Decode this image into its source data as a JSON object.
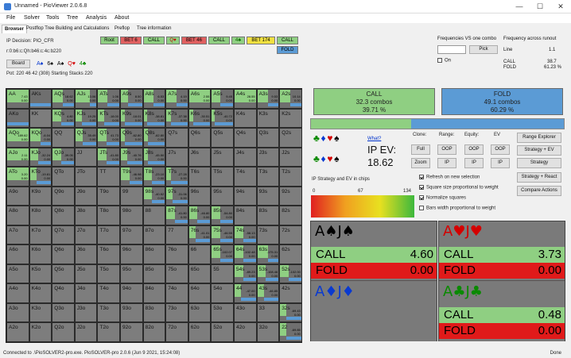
{
  "window": {
    "title": "Unnamed - PioViewer 2.0.6.8",
    "minimize": "—",
    "maximize": "☐",
    "close": "✕"
  },
  "menu": [
    "File",
    "Solver",
    "Tools",
    "Tree",
    "Analysis",
    "About"
  ],
  "tabs": [
    "Browser",
    "Postflop Tree Building and Calculations",
    "Preflop",
    "Tree information"
  ],
  "info": {
    "ip_decision": "IP Decision:  PIO_CFR",
    "board_cards": "r:0:b6:c:Qh:b46:c:4c:b220",
    "board_button": "Board",
    "board_suits": [
      "A♠",
      "6♠",
      "A♠",
      "Q♥",
      "4♣"
    ],
    "pot": "Pot: 220 46 42 (308) Starting Stacks 220"
  },
  "tree_nodes": [
    {
      "label": "Root",
      "color": "#8fcf82"
    },
    {
      "label": "BET 6",
      "color": "#e06060"
    },
    {
      "label": "CALL",
      "color": "#8fcf82"
    },
    {
      "label": "Q♥",
      "color": "#8fcf82"
    },
    {
      "label": "BET 46",
      "color": "#e06060"
    },
    {
      "label": "CALL",
      "color": "#8fcf82"
    },
    {
      "label": "4♣",
      "color": "#8fcf82"
    },
    {
      "label": "BET 174",
      "color": "#f0e040"
    },
    {
      "label": "CALL",
      "color": "#8fcf82"
    },
    {
      "label": "FOLD",
      "color": "#5b9bd5"
    }
  ],
  "freq_panel": {
    "title": "Frequencies VS one combo",
    "pick": "Pick",
    "on": "On",
    "across_title": "Frequency across runout",
    "line": "Line",
    "line_val": "1.1",
    "call": "CALL",
    "call_val": "38.7",
    "fold": "FOLD",
    "fold_val": "61.23 %"
  },
  "grid": [
    [
      "AA",
      "AKs",
      "AQs",
      "AJs",
      "ATs",
      "A9s",
      "A8s",
      "A7s",
      "A6s",
      "A5s",
      "A4s",
      "A3s",
      "A2s"
    ],
    [
      "AKo",
      "KK",
      "KQs",
      "KJs",
      "KTs",
      "K9s",
      "K8s",
      "K7s",
      "K6s",
      "K5s",
      "K4s",
      "K3s",
      "K2s"
    ],
    [
      "AQo",
      "KQo",
      "QQ",
      "QJs",
      "QTs",
      "Q9s",
      "Q8s",
      "Q7s",
      "Q6s",
      "Q5s",
      "Q4s",
      "Q3s",
      "Q2s"
    ],
    [
      "AJo",
      "KJo",
      "QJo",
      "JJ",
      "JTs",
      "J9s",
      "J8s",
      "J7s",
      "J6s",
      "J5s",
      "J4s",
      "J3s",
      "J2s"
    ],
    [
      "ATo",
      "KTo",
      "QTo",
      "JTo",
      "TT",
      "T9s",
      "T8s",
      "T7s",
      "T6s",
      "T5s",
      "T4s",
      "T3s",
      "T2s"
    ],
    [
      "A9o",
      "K9o",
      "Q9o",
      "J9o",
      "T9o",
      "99",
      "98s",
      "97s",
      "96s",
      "95s",
      "94s",
      "93s",
      "92s"
    ],
    [
      "A8o",
      "K8o",
      "Q8o",
      "J8o",
      "T8o",
      "98o",
      "88",
      "87s",
      "86s",
      "85s",
      "84s",
      "83s",
      "82s"
    ],
    [
      "A7o",
      "K7o",
      "Q7o",
      "J7o",
      "T7o",
      "97o",
      "87o",
      "77",
      "76s",
      "75s",
      "74s",
      "73s",
      "72s"
    ],
    [
      "A6o",
      "K6o",
      "Q6o",
      "J6o",
      "T6o",
      "96o",
      "86o",
      "76o",
      "66",
      "65s",
      "64s",
      "63s",
      "62s"
    ],
    [
      "A5o",
      "K5o",
      "Q5o",
      "J5o",
      "T5o",
      "95o",
      "85o",
      "75o",
      "65o",
      "55",
      "54s",
      "53s",
      "52s"
    ],
    [
      "A4o",
      "K4o",
      "Q4o",
      "J4o",
      "T4o",
      "94o",
      "84o",
      "74o",
      "64o",
      "54o",
      "44",
      "43s",
      "42s"
    ],
    [
      "A3o",
      "K3o",
      "Q3o",
      "J3o",
      "T3o",
      "93o",
      "83o",
      "73o",
      "63o",
      "53o",
      "43o",
      "33",
      "32s"
    ],
    [
      "A2o",
      "K2o",
      "Q2o",
      "J2o",
      "T2o",
      "92o",
      "82o",
      "72o",
      "62o",
      "52o",
      "42o",
      "32o",
      "22"
    ]
  ],
  "cell_values": {
    "AA": {
      "call": 1,
      "nums": "7.43\n0.00"
    },
    "AKs": {
      "call": 0,
      "nums": ""
    },
    "AQs": {
      "call": 0.5,
      "nums": "18.62\n0.00"
    },
    "AJs": {
      "call": 0.7,
      "nums": "13.06\n0.00"
    },
    "ATs": {
      "call": 0.45,
      "nums": "1.06\n0.00"
    },
    "A9s": {
      "call": 0.35,
      "nums": "8.50\n0.00"
    },
    "A8s": {
      "call": 0.45,
      "nums": "6.53\n0.00"
    },
    "A7s": {
      "call": 0.5,
      "nums": "4.19\n0.00"
    },
    "A6s": {
      "call": 1,
      "nums": "2.55\n0.00"
    },
    "A5s": {
      "call": 0.4,
      "nums": "9.45\n0.00"
    },
    "A4s": {
      "call": 1,
      "nums": "28.55\n0.00"
    },
    "A3s": {
      "call": 0.5,
      "nums": "9.53\n0.00"
    },
    "A2s": {
      "call": 0.5,
      "nums": "10.14\n0.00"
    },
    "AKo": {
      "call": 0,
      "nums": ""
    },
    "KQs": {
      "call": 0.4,
      "nums": "4.80\n0.00"
    },
    "KJs": {
      "call": 0.3,
      "nums": "19.25\n0.00"
    },
    "KTs": {
      "call": 0.3,
      "nums": "-18.00\n0.00"
    },
    "K9s": {
      "call": 0.2,
      "nums": "-18.01\n0.00"
    },
    "K8s": {
      "call": 0.15,
      "nums": "-38.81\n0.00"
    },
    "K7s": {
      "call": 0.2,
      "nums": "-37.38\n0.00"
    },
    "K6s": {
      "call": 0.2,
      "nums": "-30.51\n0.00"
    },
    "K5s": {
      "call": 0.15,
      "nums": "-40.72\n0.00"
    },
    "AQo": {
      "call": 1,
      "nums": "189.62\n0.00"
    },
    "KQo": {
      "call": 0.5,
      "nums": "-6.04\n0.00"
    },
    "QJs": {
      "call": 0.35,
      "nums": "35.49\n0.00"
    },
    "QTs": {
      "call": 0.4,
      "nums": "41.73\n0.00"
    },
    "Q9s": {
      "call": 0.2,
      "nums": "-62.80\n0.00"
    },
    "Q8s": {
      "call": 0.2,
      "nums": "-62.80\n0.00"
    },
    "AJo": {
      "call": 1,
      "nums": "2.11\n0.00"
    },
    "KJo": {
      "call": 0.4,
      "nums": "-32.24\n0.00"
    },
    "QJo": {
      "call": 0.4,
      "nums": "-39.05\n0.00"
    },
    "JTs": {
      "call": 0.4,
      "nums": "-41.80\n0.00"
    },
    "J9s": {
      "call": 0.3,
      "nums": "-40.76\n0.00"
    },
    "J8s": {
      "call": 0.2,
      "nums": "-45.50\n0.00"
    },
    "ATo": {
      "call": 1,
      "nums": "3.20\n0.00"
    },
    "KTo": {
      "call": 0.3,
      "nums": "-19.81\n0.00"
    },
    "T9s": {
      "call": 0.4,
      "nums": "-46.98\n0.00"
    },
    "T8s": {
      "call": 0.4,
      "nums": "-23.10\n0.00"
    },
    "T7s": {
      "call": 0.2,
      "nums": "-27.28\n0.00"
    },
    "98s": {
      "call": 0.4,
      "nums": "-40.52\n0.00"
    },
    "97s": {
      "call": 0.3,
      "nums": "-31.06\n0.00"
    },
    "87s": {
      "call": 0.4,
      "nums": "-41.80\n0.00"
    },
    "86s": {
      "call": 0.4,
      "nums": "-46.80\n0.00"
    },
    "85s": {
      "call": 0.4,
      "nums": "-54.80\n0.00"
    },
    "76s": {
      "call": 0.3,
      "nums": "-41.01\n0.00"
    },
    "75s": {
      "call": 0.4,
      "nums": "-46.55\n0.00"
    },
    "74s": {
      "call": 0.4,
      "nums": "-58.13\n0.00"
    },
    "65s": {
      "call": 0.4,
      "nums": "-102.07\n0.00"
    },
    "64s": {
      "call": 0.4,
      "nums": "-102.48\n0.00"
    },
    "63s": {
      "call": 0.5,
      "nums": "-175.31\n0.00"
    },
    "54s": {
      "call": 0.4,
      "nums": "-89.23\n0.00"
    },
    "53s": {
      "call": 0.4,
      "nums": "-108.46\n0.00"
    },
    "52s": {
      "call": 0.4,
      "nums": "-102.00\n0.00"
    },
    "44": {
      "call": 0.3,
      "nums": "-47.00\n0.00"
    },
    "43s": {
      "call": 0.3,
      "nums": "-46.85\n0.00"
    },
    "32s": {
      "call": 0.3,
      "nums": "-69.43\n0.00"
    },
    "22": {
      "call": 0.3,
      "nums": "-69.85\n0.00"
    }
  },
  "summary": {
    "call_label": "CALL",
    "call_combos": "32.3 combos",
    "call_pct": "39.71 %",
    "fold_label": "FOLD",
    "fold_combos": "49.1 combos",
    "fold_pct": "60.29 %",
    "call_share": 0.397
  },
  "ev_panel": {
    "what": "What?",
    "ip_ev_label": "IP EV:",
    "ip_ev_value": "18.62",
    "suits_top": [
      "♣",
      "♦",
      "♥",
      "♠"
    ],
    "suits_bottom": [
      "♣",
      "♦",
      "♥",
      "♠"
    ]
  },
  "controls": {
    "clone": "Clone:",
    "range": "Range:",
    "equity": "Equity:",
    "ev": "EV",
    "full": "Full",
    "zoom": "Zoom",
    "oop1": "OOP",
    "ip1": "IP",
    "oop2": "OOP",
    "ip2": "IP",
    "oop3": "OOP",
    "ip3": "IP",
    "range_explorer": "Range Explorer",
    "strategy_ev": "Strategy + EV",
    "strategy": "Strategy",
    "strategy_react": "Strategy + React",
    "compare": "Compare Actions"
  },
  "checkboxes": {
    "refresh": "Refresh on new selection",
    "square_size": "Square size proportional to weight",
    "normalize": "Normalize squares",
    "bars_width": "Bars width proportional to weight"
  },
  "scale": {
    "title": "IP Strategy and EV in chips",
    "min": "0",
    "mid": "67",
    "max": "134"
  },
  "combos": [
    {
      "hand": "A♠J♠",
      "suits": [
        "blk",
        "blk"
      ],
      "call": "4.60",
      "fold": "0.00"
    },
    {
      "hand": "A♥J♥",
      "suits": [
        "red",
        "red"
      ],
      "call": "3.73",
      "fold": "0.00"
    },
    {
      "hand": "A♦J♦",
      "suits": [
        "blu",
        "blu"
      ],
      "call": "",
      "fold": ""
    },
    {
      "hand": "A♣J♣",
      "suits": [
        "grn",
        "grn"
      ],
      "call": "0.48",
      "fold": "0.00"
    }
  ],
  "combo_labels": {
    "call": "CALL",
    "fold": "FOLD"
  },
  "status": {
    "left": "Connected to .\\PioSOLVER2-pro.exe. PioSOLVER-pro 2.0.6 (Jun  9 2021, 15:24:08)",
    "right": "Done"
  },
  "colors": {
    "call": "#8fcf82",
    "fold_blue": "#5b9bd5",
    "fold_red": "#e01a1a",
    "bet": "#e06060"
  }
}
